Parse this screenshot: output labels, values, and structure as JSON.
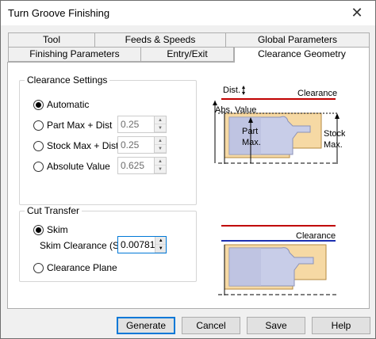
{
  "window": {
    "title": "Turn Groove Finishing",
    "close_glyph": "✕"
  },
  "tabs": {
    "row1": [
      {
        "label": "Tool"
      },
      {
        "label": "Feeds & Speeds"
      },
      {
        "label": "Global Parameters"
      }
    ],
    "row2": [
      {
        "label": "Finishing Parameters"
      },
      {
        "label": "Entry/Exit"
      },
      {
        "label": "Clearance Geometry",
        "active": true
      }
    ]
  },
  "clearance_settings": {
    "title": "Clearance Settings",
    "options": [
      {
        "label": "Automatic",
        "checked": true
      },
      {
        "label": "Part Max + Dist",
        "checked": false,
        "value": "0.25"
      },
      {
        "label": "Stock Max + Dist",
        "checked": false,
        "value": "0.25"
      },
      {
        "label": "Absolute Value",
        "checked": false,
        "value": "0.625"
      }
    ]
  },
  "cut_transfer": {
    "title": "Cut Transfer",
    "skim": {
      "label": "Skim",
      "checked": true
    },
    "skim_clearance": {
      "label": "Skim Clearance (S)",
      "value": "0.00781"
    },
    "clearance_plane": {
      "label": "Clearance Plane",
      "checked": false
    }
  },
  "diagram_top": {
    "dist_label": "Dist.",
    "clearance_label": "Clearance",
    "abs_value_label": "Abs. Value",
    "part_label_1": "Part",
    "part_label_2": "Max.",
    "stock_label_1": "Stock",
    "stock_label_2": "Max."
  },
  "diagram_bottom": {
    "clearance_label": "Clearance"
  },
  "buttons": {
    "generate": "Generate",
    "cancel": "Cancel",
    "save": "Save",
    "help": "Help"
  },
  "colors": {
    "clearance_red": "#c00000",
    "clearance_blue": "#1c2fb0",
    "stock_fill": "#f6d9a4",
    "part_fill": "#c8cde8",
    "focus_blue": "#0078d7"
  }
}
